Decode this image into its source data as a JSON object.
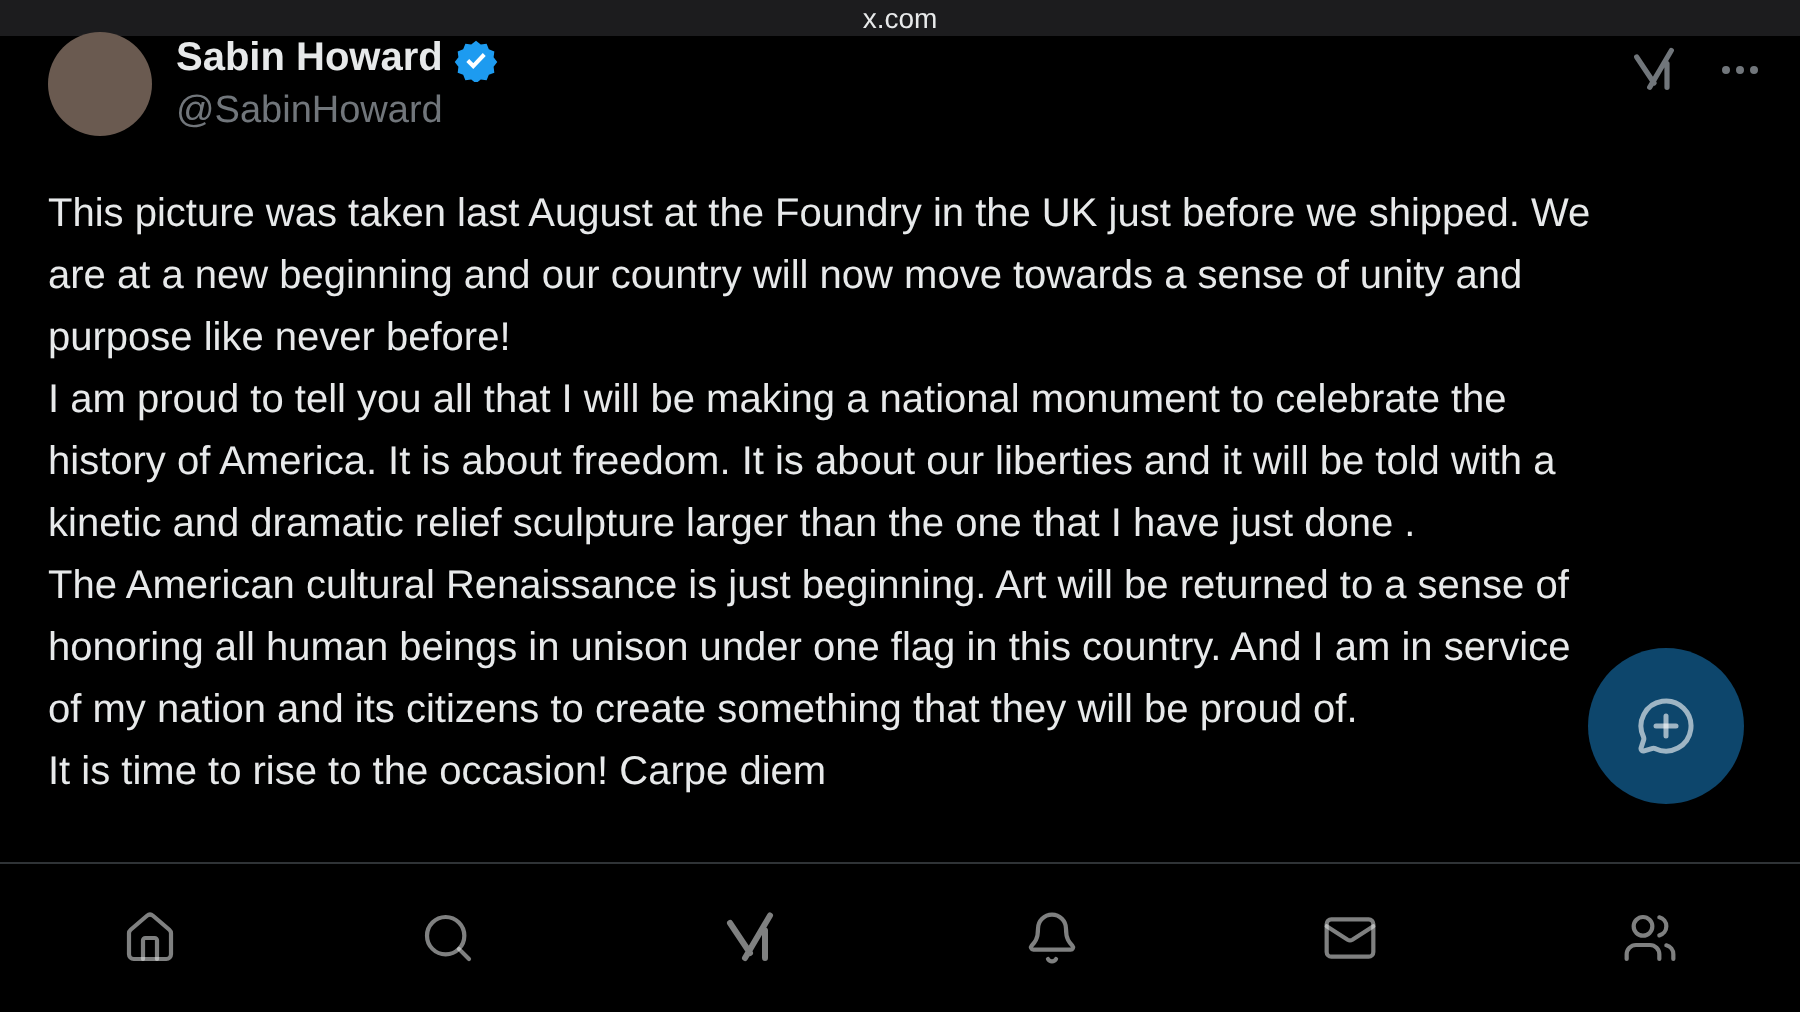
{
  "browser_bar": {
    "url": "x.com"
  },
  "author": {
    "name": "Sabin Howard",
    "handle": "@SabinHoward",
    "verified": true
  },
  "post": {
    "paragraphs": [
      "This picture was taken last August at the Foundry in the UK just before we shipped. We are at a new beginning and our country will now move towards a sense of unity and purpose like never before!",
      "I am proud to tell you all that I will be making a national monument to celebrate the history of America. It is about freedom. It is about our liberties and it will be told with a kinetic and dramatic relief sculpture larger than the one that I have just done .",
      "The American cultural Renaissance is just beginning. Art will be returned to a sense of honoring all human beings in unison under one flag in this country. And I am in service of my nation and its citizens to create something that they will be proud of.",
      "It is time to rise to the occasion! Carpe diem"
    ]
  },
  "bottom_nav": [
    {
      "kind": "home",
      "selected": false
    },
    {
      "kind": "search",
      "selected": false
    },
    {
      "kind": "grok",
      "selected": false
    },
    {
      "kind": "bell",
      "selected": false
    },
    {
      "kind": "mail",
      "selected": false
    },
    {
      "kind": "people",
      "selected": false
    }
  ]
}
